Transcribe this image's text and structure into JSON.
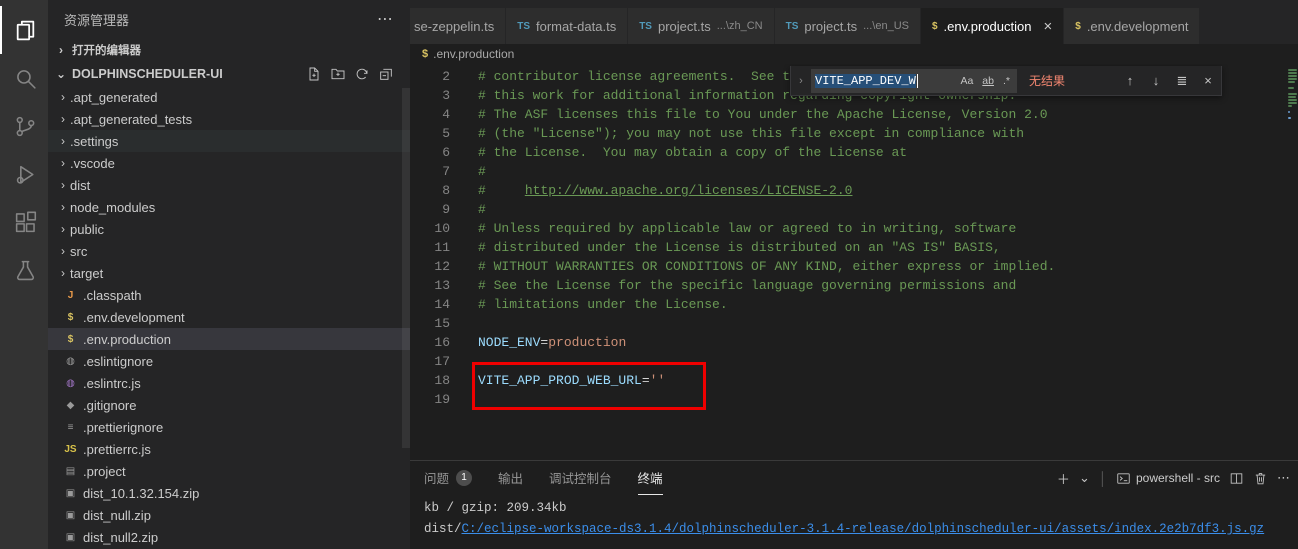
{
  "icons": {
    "more": "⋯",
    "chevron_right": "›",
    "chevron_down": "⌄",
    "close": "×",
    "arrow_up": "↑",
    "arrow_down": "↓",
    "find_selection": "≣",
    "plus": "＋",
    "divider": "│",
    "panel_more": "⋯"
  },
  "activity_bar": {
    "items": [
      "explorer-icon",
      "search-icon",
      "source-control-icon",
      "run-debug-icon",
      "extensions-icon",
      "testing-icon"
    ]
  },
  "sidebar": {
    "title": "资源管理器",
    "open_editors": "打开的编辑器",
    "root": "DOLPHINSCHEDULER-UI",
    "tree": [
      {
        "label": ".apt_generated",
        "kind": "folder"
      },
      {
        "label": ".apt_generated_tests",
        "kind": "folder"
      },
      {
        "label": ".settings",
        "kind": "folder",
        "state": "hover"
      },
      {
        "label": ".vscode",
        "kind": "folder"
      },
      {
        "label": "dist",
        "kind": "folder"
      },
      {
        "label": "node_modules",
        "kind": "folder"
      },
      {
        "label": "public",
        "kind": "folder"
      },
      {
        "label": "src",
        "kind": "folder"
      },
      {
        "label": "target",
        "kind": "folder"
      },
      {
        "label": ".classpath",
        "kind": "file",
        "icon": "java-config-icon",
        "glyph": "J",
        "color": "#e8994a"
      },
      {
        "label": ".env.development",
        "kind": "file",
        "icon": "env-file-icon",
        "glyph": "$",
        "color": "#d9c362"
      },
      {
        "label": ".env.production",
        "kind": "file",
        "icon": "env-file-icon",
        "glyph": "$",
        "color": "#d9c362",
        "state": "selected"
      },
      {
        "label": ".eslintignore",
        "kind": "file",
        "icon": "eslint-ignore-icon",
        "glyph": "◍",
        "color": "#9a9a9a"
      },
      {
        "label": ".eslintrc.js",
        "kind": "file",
        "icon": "eslint-icon",
        "glyph": "◍",
        "color": "#a074c4"
      },
      {
        "label": ".gitignore",
        "kind": "file",
        "icon": "git-icon",
        "glyph": "◆",
        "color": "#9a9a9a"
      },
      {
        "label": ".prettierignore",
        "kind": "file",
        "icon": "prettier-ignore-icon",
        "glyph": "≡",
        "color": "#9a9a9a"
      },
      {
        "label": ".prettierrc.js",
        "kind": "file",
        "icon": "js-icon",
        "glyph": "JS",
        "color": "#d8c24a"
      },
      {
        "label": ".project",
        "kind": "file",
        "icon": "project-file-icon",
        "glyph": "▤",
        "color": "#9a9a9a"
      },
      {
        "label": "dist_10.1.32.154.zip",
        "kind": "file",
        "icon": "zip-icon",
        "glyph": "▣",
        "color": "#9a9a9a"
      },
      {
        "label": "dist_null.zip",
        "kind": "file",
        "icon": "zip-icon",
        "glyph": "▣",
        "color": "#9a9a9a"
      },
      {
        "label": "dist_null2.zip",
        "kind": "file",
        "icon": "zip-icon",
        "glyph": "▣",
        "color": "#9a9a9a"
      }
    ]
  },
  "tabs": [
    {
      "label": "se-zeppelin.ts",
      "icon": "",
      "icon_name": "",
      "icon_color": "",
      "clipped": true
    },
    {
      "label": "format-data.ts",
      "icon": "TS",
      "icon_name": "typescript-icon",
      "icon_color": "#519aba"
    },
    {
      "label": "project.ts",
      "detail": "...\\zh_CN",
      "icon": "TS",
      "icon_name": "typescript-icon",
      "icon_color": "#519aba"
    },
    {
      "label": "project.ts",
      "detail": "...\\en_US",
      "icon": "TS",
      "icon_name": "typescript-icon",
      "icon_color": "#519aba"
    },
    {
      "label": ".env.production",
      "icon": "$",
      "icon_name": "env-file-icon",
      "icon_color": "#d9c362",
      "active": true,
      "close": "×"
    },
    {
      "label": ".env.development",
      "icon": "$",
      "icon_name": "env-file-icon",
      "icon_color": "#d9c362"
    }
  ],
  "breadcrumb": {
    "icon": "$",
    "label": ".env.production"
  },
  "editor": {
    "lines": [
      {
        "n": 2,
        "parts": [
          {
            "t": "# contributor license agreements.  See the NOTICE file distributed with",
            "c": "comment"
          }
        ]
      },
      {
        "n": 3,
        "parts": [
          {
            "t": "# this work for additional information regarding copyright ownership.",
            "c": "comment"
          }
        ]
      },
      {
        "n": 4,
        "parts": [
          {
            "t": "# The ASF licenses this file to You under the Apache License, Version 2.0",
            "c": "comment"
          }
        ]
      },
      {
        "n": 5,
        "parts": [
          {
            "t": "# (the \"License\"); you may not use this file except in compliance with",
            "c": "comment"
          }
        ]
      },
      {
        "n": 6,
        "parts": [
          {
            "t": "# the License.  You may obtain a copy of the License at",
            "c": "comment"
          }
        ]
      },
      {
        "n": 7,
        "parts": [
          {
            "t": "#",
            "c": "comment"
          }
        ]
      },
      {
        "n": 8,
        "parts": [
          {
            "t": "#     ",
            "c": "comment"
          },
          {
            "t": "http://www.apache.org/licenses/LICENSE-2.0",
            "c": "comment link"
          }
        ]
      },
      {
        "n": 9,
        "parts": [
          {
            "t": "#",
            "c": "comment"
          }
        ]
      },
      {
        "n": 10,
        "parts": [
          {
            "t": "# Unless required by applicable law or agreed to in writing, software",
            "c": "comment"
          }
        ]
      },
      {
        "n": 11,
        "parts": [
          {
            "t": "# distributed under the License is distributed on an \"AS IS\" BASIS,",
            "c": "comment"
          }
        ]
      },
      {
        "n": 12,
        "parts": [
          {
            "t": "# WITHOUT WARRANTIES OR CONDITIONS OF ANY KIND, either express or implied.",
            "c": "comment"
          }
        ]
      },
      {
        "n": 13,
        "parts": [
          {
            "t": "# See the License for the specific language governing permissions and",
            "c": "comment"
          }
        ]
      },
      {
        "n": 14,
        "parts": [
          {
            "t": "# limitations under the License.",
            "c": "comment"
          }
        ]
      },
      {
        "n": 15,
        "parts": []
      },
      {
        "n": 16,
        "parts": [
          {
            "t": "NODE_ENV",
            "c": "key"
          },
          {
            "t": "=",
            "c": "op"
          },
          {
            "t": "production",
            "c": "val"
          }
        ]
      },
      {
        "n": 17,
        "parts": []
      },
      {
        "n": 18,
        "parts": [
          {
            "t": "VITE_APP_PROD_WEB_URL",
            "c": "key"
          },
          {
            "t": "=",
            "c": "op"
          },
          {
            "t": "''",
            "c": "val"
          }
        ]
      },
      {
        "n": 19,
        "parts": []
      }
    ]
  },
  "find": {
    "query": "VITE_APP_DEV_W",
    "match_case": "Aa",
    "whole_word": "ab",
    "regex": ".*",
    "result": "无结果"
  },
  "panel": {
    "tabs": [
      {
        "label": "问题",
        "badge": "1"
      },
      {
        "label": "输出"
      },
      {
        "label": "调试控制台"
      },
      {
        "label": "终端",
        "active": true
      }
    ],
    "shell_label": "powershell - src",
    "terminal_lines": [
      {
        "parts": [
          {
            "t": "kb / gzip: 209.34kb",
            "c": "plain"
          }
        ]
      },
      {
        "parts": [
          {
            "t": "dist/",
            "c": "plain"
          },
          {
            "t": "C:/eclipse-workspace-ds3.1.4/dolphinscheduler-3.1.4-release/dolphinscheduler-ui/assets/index.2e2b7df3.js.gz",
            "c": "link"
          }
        ]
      }
    ]
  }
}
